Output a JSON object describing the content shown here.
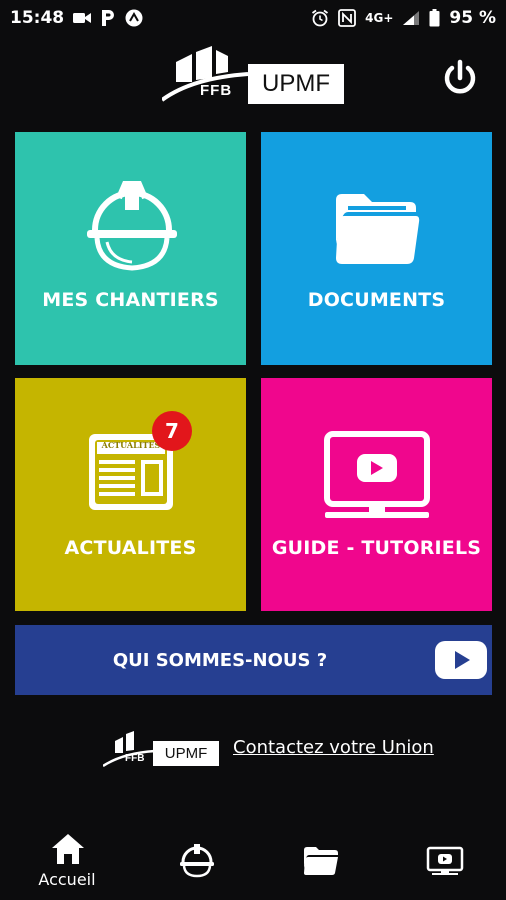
{
  "status_bar": {
    "time": "15:48",
    "network": "4G+",
    "battery": "95 %"
  },
  "header": {
    "logo_ffb": "FFB",
    "logo_upmf": "UPMF"
  },
  "tiles": [
    {
      "label": "MES CHANTIERS",
      "color": "#2ec3ad",
      "icon": "hard-hat-icon"
    },
    {
      "label": "DOCUMENTS",
      "color": "#139fe0",
      "icon": "folder-icon"
    },
    {
      "label": "ACTUALITES",
      "color": "#c5b500",
      "icon": "newspaper-icon",
      "badge": "7",
      "newspaper_text": "ACTUALITES"
    },
    {
      "label": "GUIDE - TUTORIELS",
      "color": "#f0068d",
      "icon": "video-monitor-icon"
    }
  ],
  "banner": {
    "label": "QUI SOMMES-NOUS ?",
    "color": "#263f91",
    "icon": "youtube-play-icon"
  },
  "footer": {
    "logo_ffb": "FFB",
    "logo_upmf": "UPMF",
    "contact_link": "Contactez votre Union"
  },
  "nav": [
    {
      "label": "Accueil",
      "icon": "home-icon"
    },
    {
      "label": "",
      "icon": "hard-hat-icon"
    },
    {
      "label": "",
      "icon": "folder-icon"
    },
    {
      "label": "",
      "icon": "video-monitor-icon"
    }
  ]
}
